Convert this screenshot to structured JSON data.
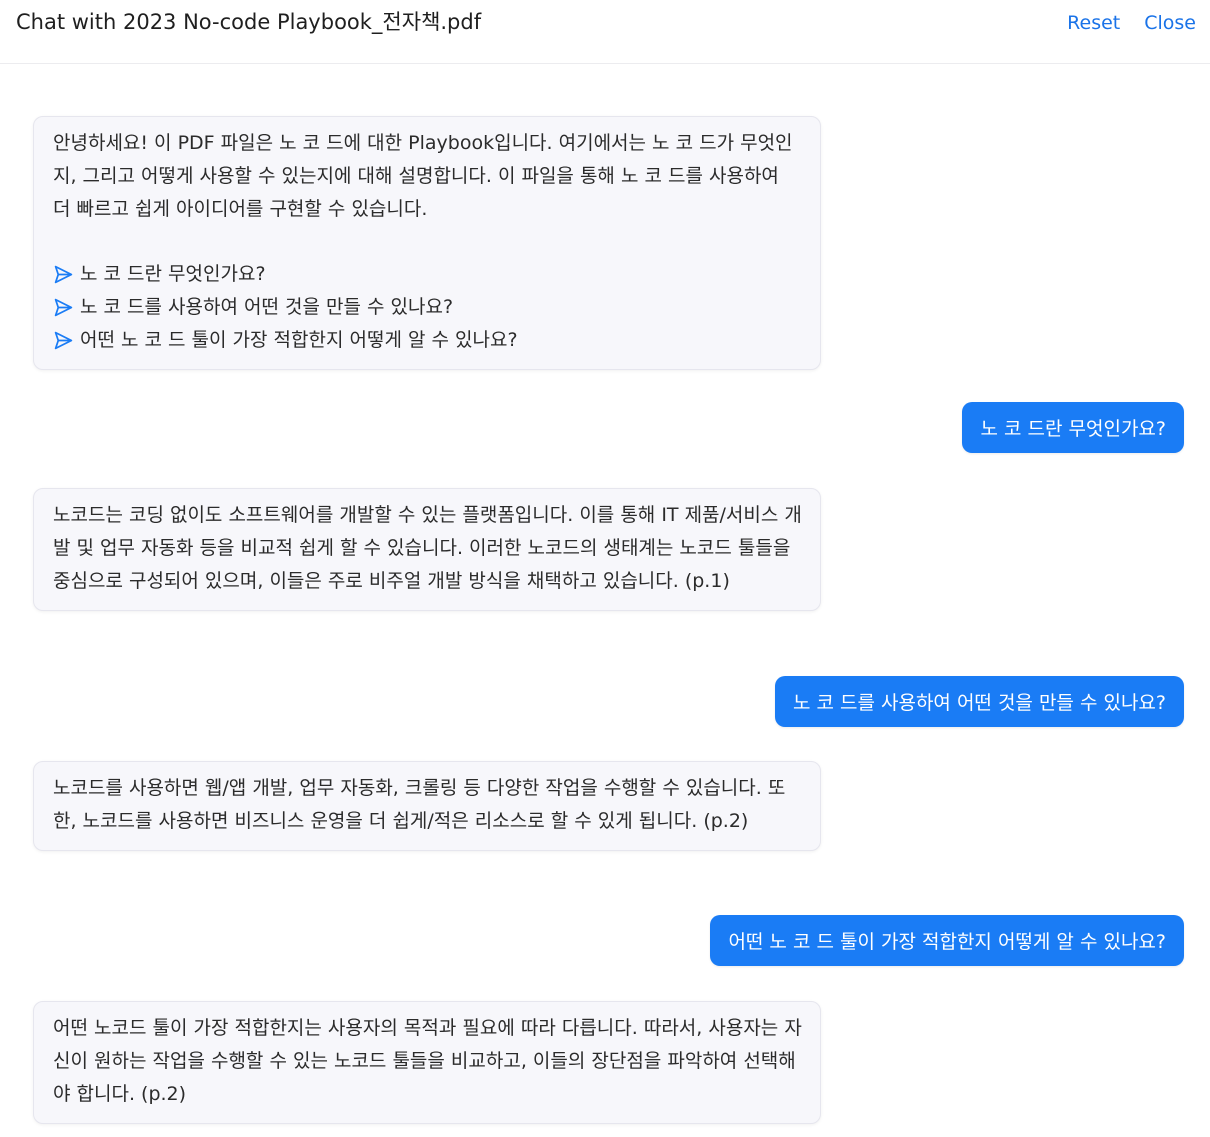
{
  "header": {
    "title": "Chat with 2023 No-code Playbook_전자책.pdf",
    "reset_label": "Reset",
    "close_label": "Close"
  },
  "colors": {
    "accent": "#1a7cf5",
    "link": "#1a73e8",
    "bot_bubble_bg": "#f7f7fb"
  },
  "messages": [
    {
      "role": "assistant",
      "text": "안녕하세요! 이 PDF 파일은 노 코 드에 대한 Playbook입니다. 여기에서는 노 코 드가 무엇인지, 그리고 어떻게 사용할 수 있는지에 대해 설명합니다. 이 파일을 통해 노 코 드를 사용하여 더 빠르고 쉽게 아이디어를 구현할 수 있습니다.",
      "suggestions": [
        "노 코 드란 무엇인가요?",
        "노 코 드를 사용하여 어떤 것을 만들 수 있나요?",
        "어떤 노 코 드 툴이 가장 적합한지 어떻게 알 수 있나요?"
      ],
      "suggestion_icon": "send-arrow-icon"
    },
    {
      "role": "user",
      "text": "노 코 드란 무엇인가요?"
    },
    {
      "role": "assistant",
      "text": "노코드는 코딩 없이도 소프트웨어를 개발할 수 있는 플랫폼입니다. 이를 통해 IT 제품/서비스 개발 및 업무 자동화 등을 비교적 쉽게 할 수 있습니다. 이러한 노코드의 생태계는 노코드 툴들을 중심으로 구성되어 있으며, 이들은 주로 비주얼 개발 방식을 채택하고 있습니다. (p.1)"
    },
    {
      "role": "user",
      "text": "노 코 드를 사용하여 어떤 것을 만들 수 있나요?"
    },
    {
      "role": "assistant",
      "text": "노코드를 사용하면 웹/앱 개발, 업무 자동화, 크롤링 등 다양한 작업을 수행할 수 있습니다. 또한, 노코드를 사용하면 비즈니스 운영을 더 쉽게/적은 리소스로 할 수 있게 됩니다. (p.2)"
    },
    {
      "role": "user",
      "text": "어떤 노 코 드 툴이 가장 적합한지 어떻게 알 수 있나요?"
    },
    {
      "role": "assistant",
      "text": "어떤 노코드 툴이 가장 적합한지는 사용자의 목적과 필요에 따라 다릅니다. 따라서, 사용자는 자신이 원하는 작업을 수행할 수 있는 노코드 툴들을 비교하고, 이들의 장단점을 파악하여 선택해야 합니다. (p.2)"
    }
  ]
}
